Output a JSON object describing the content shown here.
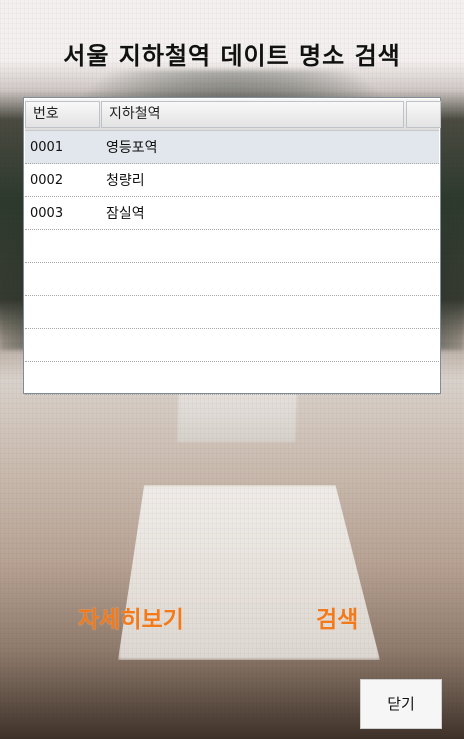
{
  "title": "서울 지하철역 데이트 명소 검색",
  "listview": {
    "columns": [
      "번호",
      "지하철역",
      ""
    ],
    "rows": [
      {
        "no": "0001",
        "name": "영등포역",
        "selected": true
      },
      {
        "no": "0002",
        "name": "청량리",
        "selected": false
      },
      {
        "no": "0003",
        "name": "잠실역",
        "selected": false
      },
      {
        "no": "",
        "name": "",
        "selected": false
      },
      {
        "no": "",
        "name": "",
        "selected": false
      },
      {
        "no": "",
        "name": "",
        "selected": false
      },
      {
        "no": "",
        "name": "",
        "selected": false
      },
      {
        "no": "",
        "name": "",
        "selected": false
      }
    ]
  },
  "actions": {
    "detail_label": "자세히보기",
    "search_label": "검색",
    "close_label": "닫기"
  },
  "colors": {
    "accent": "#f27a1a",
    "selected_row": "#e1e7ec"
  }
}
